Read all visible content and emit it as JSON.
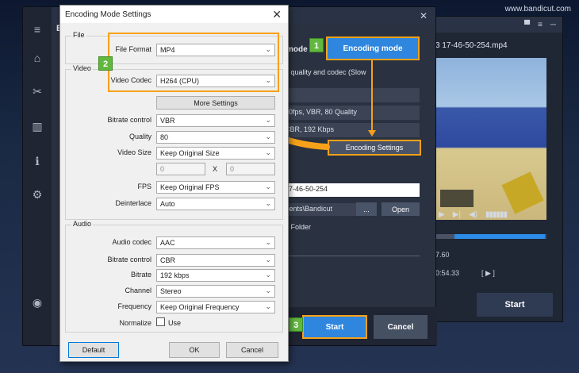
{
  "watermark": "www.bandicut.com",
  "bandicut_right": {
    "filename": "3 17-46-50-254.mp4",
    "time_a": "7.60",
    "time_b": "0:54.33",
    "frame_controls": "[ ▶ ]",
    "start_label": "Start"
  },
  "bandicut_main": {
    "title_initial": "B",
    "mode_title": "mode",
    "encoding_mode_label": "Encoding mode",
    "description": "t, quality and codec (Slow",
    "spec_row1": "00fps, VBR, 80 Quality",
    "spec_row2": "CBR, 192 Kbps",
    "encoding_settings_label": "Encoding Settings",
    "output_name": "17-46-50-254",
    "folder_path": "ments\\Bandicut",
    "browse_label": "...",
    "open_label": "Open",
    "folder_option": "e Folder",
    "start_label": "Start",
    "cancel_label": "Cancel"
  },
  "badges": {
    "one": "1",
    "two": "2",
    "three": "3"
  },
  "dialog": {
    "title": "Encoding Mode Settings",
    "close": "✕",
    "groups": {
      "file": "File",
      "video": "Video",
      "audio": "Audio"
    },
    "file_format": {
      "label": "File Format",
      "value": "MP4"
    },
    "video_codec": {
      "label": "Video Codec",
      "value": "H264 (CPU)"
    },
    "more_settings": "More Settings",
    "bitrate_control": {
      "label": "Bitrate control",
      "value": "VBR"
    },
    "quality": {
      "label": "Quality",
      "value": "80"
    },
    "video_size": {
      "label": "Video Size",
      "value": "Keep Original Size",
      "w": "0",
      "x": "X",
      "h": "0"
    },
    "fps": {
      "label": "FPS",
      "value": "Keep Original FPS"
    },
    "deinterlace": {
      "label": "Deinterlace",
      "value": "Auto"
    },
    "audio_codec": {
      "label": "Audio codec",
      "value": "AAC"
    },
    "audio_bitrate_control": {
      "label": "Bitrate control",
      "value": "CBR"
    },
    "bitrate": {
      "label": "Bitrate",
      "value": "192 kbps"
    },
    "channel": {
      "label": "Channel",
      "value": "Stereo"
    },
    "frequency": {
      "label": "Frequency",
      "value": "Keep Original Frequency"
    },
    "normalize": {
      "label": "Normalize",
      "checkbox_label": "Use"
    },
    "buttons": {
      "default": "Default",
      "ok": "OK",
      "cancel": "Cancel"
    }
  },
  "colors": {
    "accent": "#2e86de",
    "highlight": "#f7a11a",
    "badge": "#62b83f"
  }
}
